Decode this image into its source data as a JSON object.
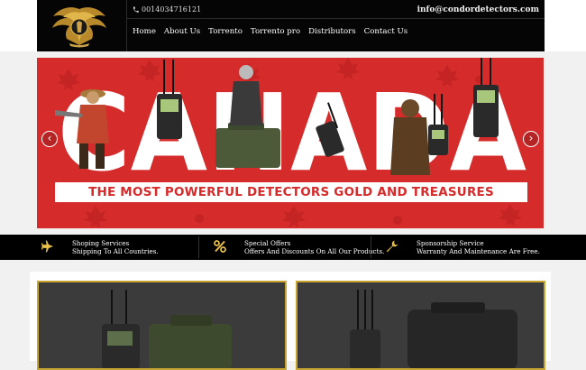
{
  "header": {
    "logo_icon": "eagle-logo",
    "phone_icon": "phone-icon",
    "phone": "0014034716121",
    "email": "info@condordetectors.com",
    "nav": [
      "Home",
      "About Us",
      "Torrento",
      "Torrento pro",
      "Distributors",
      "Contact Us"
    ]
  },
  "slider": {
    "headline": "CANADA",
    "banner": "THE MOST POWERFUL DETECTORS GOLD AND TREASURES",
    "prev_icon": "chevron-left-icon",
    "next_icon": "chevron-right-icon",
    "colors": {
      "background": "#d52b2b",
      "text": "#ffffff"
    }
  },
  "services": [
    {
      "icon": "airplane-icon",
      "title": "Shoping Services",
      "subtitle": "Shipping To All Countries."
    },
    {
      "icon": "percent-icon",
      "title": "Special Offers",
      "subtitle": "Offers And Discounts On All Our Products."
    },
    {
      "icon": "wrench-icon",
      "title": "Sponsorship Service",
      "subtitle": "Warranty And Maintenance Are Free."
    }
  ],
  "colors": {
    "accent": "#c8a430",
    "bar": "#000000"
  }
}
